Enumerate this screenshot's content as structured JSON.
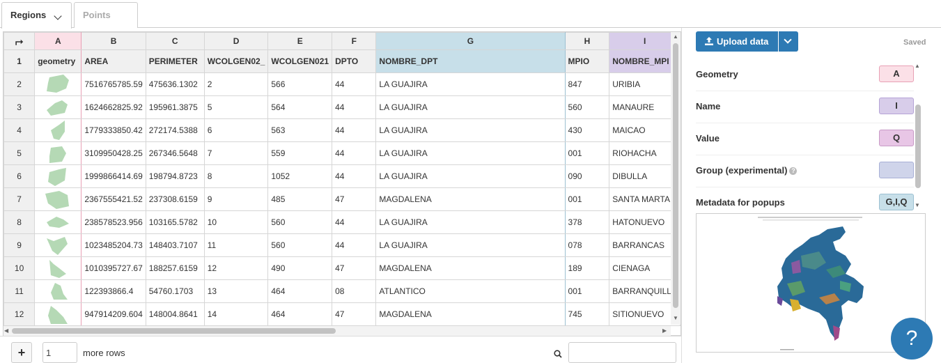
{
  "tabs": [
    {
      "label": "Regions",
      "active": true
    },
    {
      "label": "Points",
      "active": false
    }
  ],
  "grid": {
    "columns": [
      "A",
      "B",
      "C",
      "D",
      "E",
      "F",
      "G",
      "H",
      "I"
    ],
    "header_row_number": "1",
    "headers": [
      "geometry",
      "AREA",
      "PERIMETER",
      "WCOLGEN02_",
      "WCOLGEN021",
      "DPTO",
      "NOMBRE_DPT",
      "MPIO",
      "NOMBRE_MPI"
    ],
    "rows": [
      {
        "n": "2",
        "area": "7516765785.59",
        "perimeter": "475636.1302",
        "wcol": "2",
        "wcol1": "566",
        "dpto": "44",
        "nombre_dpt": "LA GUAJIRA",
        "mpio": "847",
        "nombre_mpi": "URIBIA"
      },
      {
        "n": "3",
        "area": "1624662825.92",
        "perimeter": "195961.3875",
        "wcol": "5",
        "wcol1": "564",
        "dpto": "44",
        "nombre_dpt": "LA GUAJIRA",
        "mpio": "560",
        "nombre_mpi": "MANAURE"
      },
      {
        "n": "4",
        "area": "1779333850.42",
        "perimeter": "272174.5388",
        "wcol": "6",
        "wcol1": "563",
        "dpto": "44",
        "nombre_dpt": "LA GUAJIRA",
        "mpio": "430",
        "nombre_mpi": "MAICAO"
      },
      {
        "n": "5",
        "area": "3109950428.25",
        "perimeter": "267346.5648",
        "wcol": "7",
        "wcol1": "559",
        "dpto": "44",
        "nombre_dpt": "LA GUAJIRA",
        "mpio": "001",
        "nombre_mpi": "RIOHACHA"
      },
      {
        "n": "6",
        "area": "1999866414.69",
        "perimeter": "198794.8723",
        "wcol": "8",
        "wcol1": "1052",
        "dpto": "44",
        "nombre_dpt": "LA GUAJIRA",
        "mpio": "090",
        "nombre_mpi": "DIBULLA"
      },
      {
        "n": "7",
        "area": "2367555421.52",
        "perimeter": "237308.6159",
        "wcol": "9",
        "wcol1": "485",
        "dpto": "47",
        "nombre_dpt": "MAGDALENA",
        "mpio": "001",
        "nombre_mpi": "SANTA MARTA"
      },
      {
        "n": "8",
        "area": "238578523.956",
        "perimeter": "103165.5782",
        "wcol": "10",
        "wcol1": "560",
        "dpto": "44",
        "nombre_dpt": "LA GUAJIRA",
        "mpio": "378",
        "nombre_mpi": "HATONUEVO"
      },
      {
        "n": "9",
        "area": "1023485204.73",
        "perimeter": "148403.7107",
        "wcol": "11",
        "wcol1": "560",
        "dpto": "44",
        "nombre_dpt": "LA GUAJIRA",
        "mpio": "078",
        "nombre_mpi": "BARRANCAS"
      },
      {
        "n": "10",
        "area": "1010395727.67",
        "perimeter": "188257.6159",
        "wcol": "12",
        "wcol1": "490",
        "dpto": "47",
        "nombre_dpt": "MAGDALENA",
        "mpio": "189",
        "nombre_mpi": "CIENAGA"
      },
      {
        "n": "11",
        "area": "122393866.4",
        "perimeter": "54760.1703",
        "wcol": "13",
        "wcol1": "464",
        "dpto": "08",
        "nombre_dpt": "ATLANTICO",
        "mpio": "001",
        "nombre_mpi": "BARRANQUILLA"
      },
      {
        "n": "12",
        "area": "947914209.604",
        "perimeter": "148004.8641",
        "wcol": "14",
        "wcol1": "464",
        "dpto": "47",
        "nombre_dpt": "MAGDALENA",
        "mpio": "745",
        "nombre_mpi": "SITIONUEVO"
      }
    ]
  },
  "bottombar": {
    "add_label": "+",
    "rows_value": "1",
    "more_rows_label": "more rows"
  },
  "panel": {
    "upload_label": "Upload data",
    "saved_label": "Saved",
    "bindings": [
      {
        "label": "Geometry",
        "value": "A",
        "color": "#fbe0e7",
        "border": "#e8a0b5"
      },
      {
        "label": "Name",
        "value": "I",
        "color": "#d8cdea",
        "border": "#b5a3d6"
      },
      {
        "label": "Value",
        "value": "Q",
        "color": "#e8c6e6",
        "border": "#c89ac6"
      },
      {
        "label": "Group (experimental)",
        "value": "",
        "color": "#cfd4ea",
        "border": "#a8b0d6",
        "help": "?"
      },
      {
        "label": "Metadata for popups",
        "value": "G,I,Q",
        "color": "#c7dfe9",
        "border": "#9cc0d2"
      }
    ]
  },
  "help_button_label": "?",
  "colors": {
    "accent": "#2d7ab4",
    "geometry_shape": "#b5d9b5",
    "col_a": "#fbe0e7",
    "col_g": "#c7dfe9",
    "col_i": "#d8cdea"
  }
}
